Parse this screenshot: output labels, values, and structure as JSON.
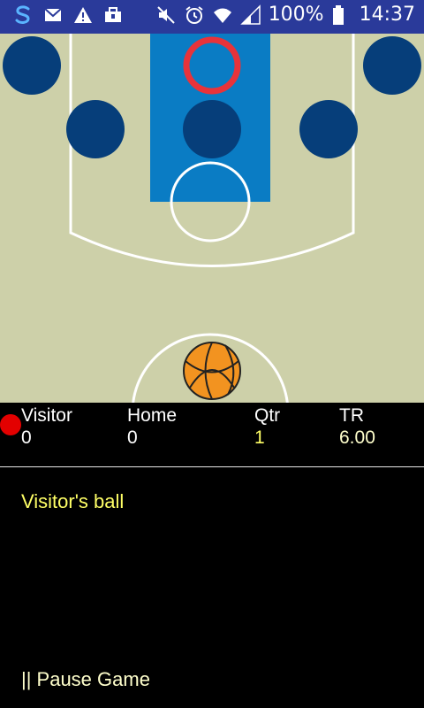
{
  "status_bar": {
    "battery": "100%",
    "time": "14:37",
    "left_icons": [
      "s-logo-icon",
      "mail-icon",
      "warning-icon",
      "briefcase-icon"
    ],
    "right_icons": [
      "mute-icon",
      "alarm-icon",
      "wifi-icon",
      "signal-icon",
      "battery-icon"
    ]
  },
  "court": {
    "colors": {
      "floor": "#cdd0a9",
      "paint": "#0a7cc4",
      "player": "#063e7a",
      "rim": "#e8333a",
      "ball": "#f29320",
      "lines": "#ffffff"
    },
    "players": [
      "player-1",
      "player-2",
      "player-3",
      "player-4",
      "player-5"
    ]
  },
  "scoreboard": {
    "visitor_label": "Visitor",
    "visitor_score": "0",
    "home_label": "Home",
    "home_score": "0",
    "qtr_label": "Qtr",
    "qtr_value": "1",
    "tr_label": "TR",
    "tr_value": "6.00"
  },
  "message": "Visitor's ball",
  "pause_label": "|| Pause Game"
}
